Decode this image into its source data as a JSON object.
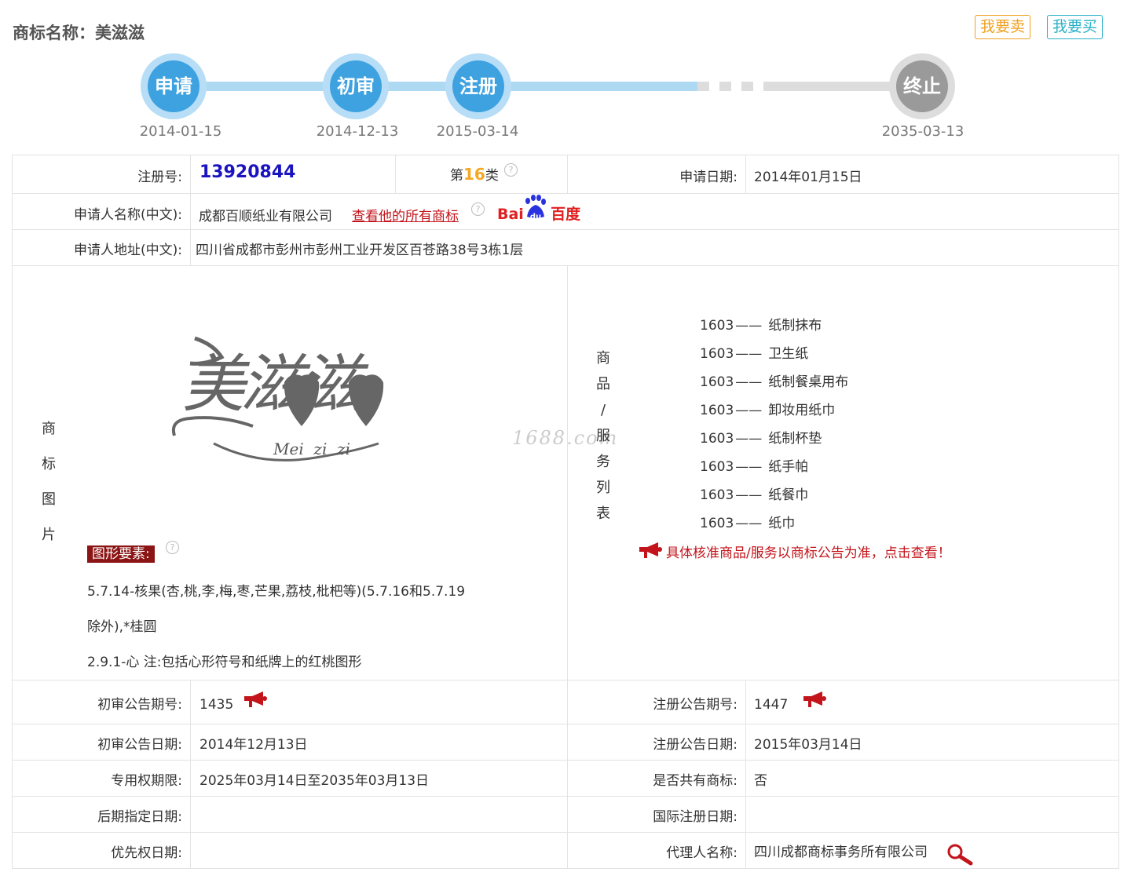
{
  "header": {
    "title_prefix": "商标名称：",
    "title_name": "美滋滋",
    "sell_button": "我要卖",
    "buy_button": "我要买"
  },
  "timeline": [
    {
      "label": "申请",
      "date": "2014-01-15"
    },
    {
      "label": "初审",
      "date": "2014-12-13"
    },
    {
      "label": "注册",
      "date": "2015-03-14"
    },
    {
      "label": "终止",
      "date": "2035-03-13"
    }
  ],
  "info": {
    "reg_no_label": "注册号:",
    "reg_no": "13920844",
    "class_prefix": "第",
    "class_num": "16",
    "class_suffix": "类",
    "apply_date_label": "申请日期:",
    "apply_date": "2014年01月15日",
    "applicant_label": "申请人名称(中文):",
    "applicant": "成都百顺纸业有限公司",
    "view_all_link": "查看他的所有商标",
    "baidu_prefix": "Bai",
    "baidu_du": "du",
    "baidu_suffix": "百度",
    "address_label": "申请人地址(中文):",
    "address": "四川省成都市彭州市彭州工业开发区百苍路38号3栋1层"
  },
  "image_section": {
    "label_chars": [
      "商",
      "标",
      "图",
      "片"
    ],
    "logo_main": "美滋滋",
    "logo_roman": "Mei  zi  zi",
    "figure_tag": "图形要素:",
    "figure_lines": [
      "5.7.14-核果(杏,桃,李,梅,枣,芒果,荔枝,枇杷等)(5.7.16和5.7.19",
      "除外),*桂圆",
      "2.9.1-心 注:包括心形符号和纸牌上的红桃图形"
    ]
  },
  "goods_section": {
    "label_chars": [
      "商",
      "品",
      "/",
      "服",
      "务",
      "列",
      "表"
    ],
    "items": [
      {
        "code": "1603",
        "name": "纸制抹布"
      },
      {
        "code": "1603",
        "name": "卫生纸"
      },
      {
        "code": "1603",
        "name": "纸制餐桌用布"
      },
      {
        "code": "1603",
        "name": "卸妆用纸巾"
      },
      {
        "code": "1603",
        "name": "纸制杯垫"
      },
      {
        "code": "1603",
        "name": "纸手帕"
      },
      {
        "code": "1603",
        "name": "纸餐巾"
      },
      {
        "code": "1603",
        "name": "纸巾"
      }
    ],
    "dash": "——",
    "notice": "具体核准商品/服务以商标公告为准，点击查看！",
    "watermark": "1688.com"
  },
  "details": {
    "prelim_no_label": "初审公告期号:",
    "prelim_no": "1435",
    "reg_no_pub_label": "注册公告期号:",
    "reg_no_pub": "1447",
    "prelim_date_label": "初审公告日期:",
    "prelim_date": "2014年12月13日",
    "reg_date_label": "注册公告日期:",
    "reg_date": "2015年03月14日",
    "term_label": "专用权期限:",
    "term": "2025年03月14日至2035年03月13日",
    "shared_label": "是否共有商标:",
    "shared": "否",
    "later_label": "后期指定日期:",
    "later": "",
    "intl_label": "国际注册日期:",
    "intl": "",
    "priority_label": "优先权日期:",
    "priority": "",
    "agent_label": "代理人名称:",
    "agent": "四川成都商标事务所有限公司"
  },
  "colors": {
    "timeline_active": "#3ea2e1",
    "timeline_end": "#9a9a9a",
    "reg_no": "#1a14c0",
    "class_num": "#f5a623",
    "link_red": "#c3141b",
    "figure_tag_bg": "#8b1414"
  },
  "icons": [
    "help-icon",
    "megaphone-icon",
    "search-icon",
    "baidu-paw-icon"
  ]
}
